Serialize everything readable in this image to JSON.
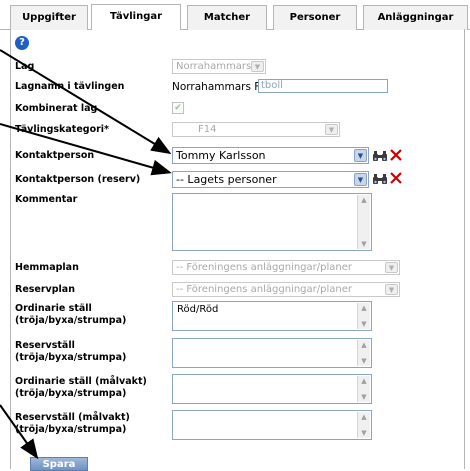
{
  "tabs": [
    {
      "label": "Uppgifter",
      "active": false
    },
    {
      "label": "Tävlingar",
      "active": true
    },
    {
      "label": "Matcher",
      "active": false
    },
    {
      "label": "Personer",
      "active": false
    },
    {
      "label": "Anläggningar",
      "active": false
    }
  ],
  "help_icon": "?",
  "form": {
    "lag": {
      "label": "Lag",
      "value": "Norrahammars IK"
    },
    "lagnamn": {
      "label": "Lagnamn i tävlingen",
      "prefix": "Norrahammars Fo",
      "input_value": "tboll"
    },
    "kombinerat": {
      "label": "Kombinerat lag",
      "checked": true
    },
    "kategori": {
      "label": "Tävlingskategori*",
      "value": "F14"
    },
    "kontakt": {
      "label": "Kontaktperson",
      "value": "Tommy Karlsson"
    },
    "kontakt_reserv": {
      "label": "Kontaktperson (reserv)",
      "value": "-- Lagets personer"
    },
    "kommentar": {
      "label": "Kommentar",
      "value": ""
    },
    "hemmaplan": {
      "label": "Hemmaplan",
      "value": "-- Föreningens anläggningar/planer"
    },
    "reservplan": {
      "label": "Reservplan",
      "value": "-- Föreningens anläggningar/planer"
    },
    "ordinarie": {
      "label_1": "Ordinarie ställ",
      "label_2": "(tröja/byxa/strumpa)",
      "value": "Röd/Röd"
    },
    "reservstall": {
      "label_1": "Reservställ",
      "label_2": "(tröja/byxa/strumpa)",
      "value": ""
    },
    "ordinarie_malvakt": {
      "label_1": "Ordinarie ställ (målvakt)",
      "label_2": "(tröja/byxa/strumpa)",
      "value": ""
    },
    "reserv_malvakt": {
      "label_1": "Reservställ (målvakt)",
      "label_2": "(tröja/byxa/strumpa)",
      "value": ""
    }
  },
  "save_label": "Spara",
  "icons": {
    "dropdown": "chevron-down-icon",
    "search": "binoculars-icon",
    "delete": "delete-x-icon",
    "check": "checkmark-icon"
  },
  "colors": {
    "border_blue": "#8aa4c8",
    "delete_red": "#cc0000",
    "save_blue": "#6e92c2",
    "arrow": "#000000"
  }
}
